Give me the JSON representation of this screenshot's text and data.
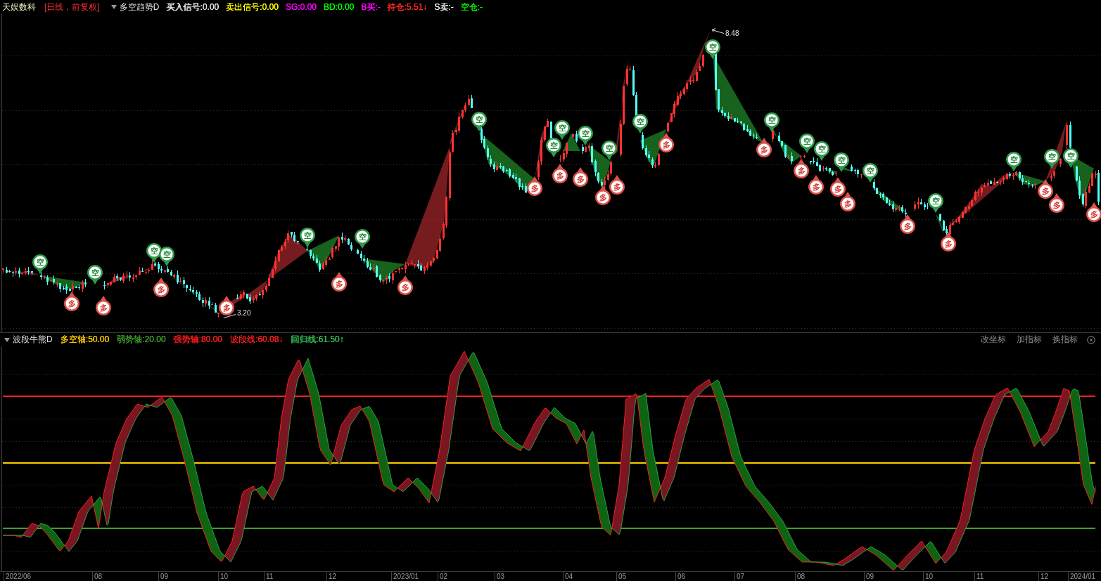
{
  "top_bar": {
    "stock_name": "天娱数科",
    "period": "[日线，前复权]",
    "indicator": "多空趋势D",
    "readouts": [
      {
        "text": "买入信号:0.00",
        "color": "#e6e6e6"
      },
      {
        "text": "卖出信号:0.00",
        "color": "#ffff00"
      },
      {
        "text": "SG:0.00",
        "color": "#ff00ff"
      },
      {
        "text": "BD:0.00",
        "color": "#00ff00"
      },
      {
        "text": "B买:-",
        "color": "#ff00ff"
      },
      {
        "text": "持仓:5.51↓",
        "color": "#ff2a2a"
      },
      {
        "text": "S卖:-",
        "color": "#e6e6e6"
      },
      {
        "text": "空仓:-",
        "color": "#00ff00"
      }
    ]
  },
  "price_chart": {
    "high_label": "8.48",
    "low_label": "3.20",
    "signals": [
      {
        "kind": "short",
        "label": "空"
      },
      {
        "kind": "long",
        "label": "多"
      },
      {
        "kind": "short",
        "label": "空"
      },
      {
        "kind": "long",
        "label": "多"
      },
      {
        "kind": "short",
        "label": "空"
      },
      {
        "kind": "long",
        "label": "多"
      },
      {
        "kind": "short",
        "label": "空"
      },
      {
        "kind": "long",
        "label": "多"
      },
      {
        "kind": "short",
        "label": "空"
      },
      {
        "kind": "long",
        "label": "多"
      },
      {
        "kind": "short",
        "label": "空"
      },
      {
        "kind": "long",
        "label": "多"
      },
      {
        "kind": "short",
        "label": "空"
      },
      {
        "kind": "long",
        "label": "多"
      },
      {
        "kind": "short",
        "label": "空"
      },
      {
        "kind": "long",
        "label": "多"
      },
      {
        "kind": "short",
        "label": "空"
      },
      {
        "kind": "long",
        "label": "多"
      },
      {
        "kind": "short",
        "label": "空"
      },
      {
        "kind": "long",
        "label": "多"
      },
      {
        "kind": "short",
        "label": "空"
      },
      {
        "kind": "long",
        "label": "多"
      },
      {
        "kind": "short",
        "label": "空"
      },
      {
        "kind": "long",
        "label": "多"
      },
      {
        "kind": "short",
        "label": "空"
      },
      {
        "kind": "long",
        "label": "多"
      },
      {
        "kind": "short",
        "label": "空"
      },
      {
        "kind": "long",
        "label": "多"
      },
      {
        "kind": "short",
        "label": "空"
      },
      {
        "kind": "long",
        "label": "多"
      },
      {
        "kind": "short",
        "label": "空"
      },
      {
        "kind": "long",
        "label": "多"
      },
      {
        "kind": "short",
        "label": "空"
      },
      {
        "kind": "long",
        "label": "多"
      },
      {
        "kind": "short",
        "label": "空"
      },
      {
        "kind": "long",
        "label": "多"
      },
      {
        "kind": "short",
        "label": "空"
      },
      {
        "kind": "long",
        "label": "多"
      },
      {
        "kind": "short",
        "label": "空"
      },
      {
        "kind": "long",
        "label": "多"
      },
      {
        "kind": "short",
        "label": "空"
      },
      {
        "kind": "long",
        "label": "多"
      },
      {
        "kind": "short",
        "label": "空"
      },
      {
        "kind": "long",
        "label": "多"
      }
    ]
  },
  "indicator_header": {
    "indicator": "波段牛熊D",
    "readouts": [
      {
        "text": "多空轴:50.00",
        "color": "#ffcc00"
      },
      {
        "text": "弱势轴:20.00",
        "color": "#3fa02a"
      },
      {
        "text": "强势轴:80.00",
        "color": "#ff1e1e"
      },
      {
        "text": "波段线:60.08↓",
        "color": "#ff1e1e"
      },
      {
        "text": "回归线:61.50↑",
        "color": "#33bb55"
      }
    ],
    "tools": [
      "改坐标",
      "加指标",
      "换指标"
    ]
  },
  "time_axis": [
    "2022/06",
    "08",
    "09",
    "10",
    "11",
    "12",
    "2023/01",
    "02",
    "03",
    "04",
    "05",
    "06",
    "07",
    "08",
    "09",
    "10",
    "11",
    "12",
    "2024/01"
  ]
}
